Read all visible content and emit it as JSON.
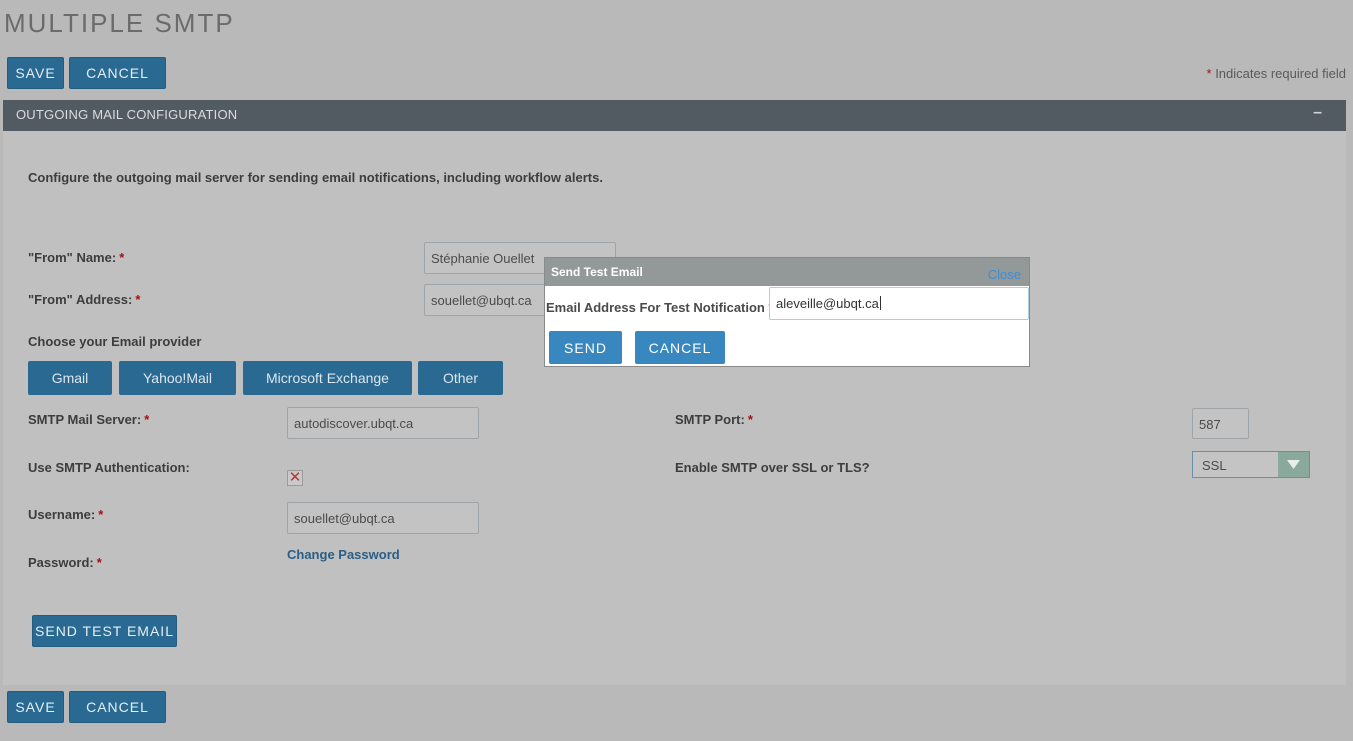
{
  "page": {
    "title": "MULTIPLE SMTP",
    "save_label": "SAVE",
    "cancel_label": "CANCEL",
    "required_star": "*",
    "required_note": "Indicates required field"
  },
  "panel": {
    "title": "OUTGOING MAIL CONFIGURATION",
    "collapse_symbol": "–",
    "description": "Configure the outgoing mail server for sending email notifications, including workflow alerts."
  },
  "form": {
    "from_name_label": "\"From\" Name:",
    "from_name_value": "Stéphanie Ouellet",
    "from_address_label": "\"From\" Address:",
    "from_address_value": "souellet@ubqt.ca",
    "provider_label": "Choose your Email provider",
    "providers": [
      "Gmail",
      "Yahoo!Mail",
      "Microsoft Exchange",
      "Other"
    ],
    "smtp_server_label": "SMTP Mail Server:",
    "smtp_server_value": "autodiscover.ubqt.ca",
    "smtp_port_label": "SMTP Port:",
    "smtp_port_value": "587",
    "use_auth_label": "Use SMTP Authentication:",
    "use_auth_checked": true,
    "ssl_label": "Enable SMTP over SSL or TLS?",
    "ssl_value": "SSL",
    "username_label": "Username:",
    "username_value": "souellet@ubqt.ca",
    "password_label": "Password:",
    "change_password_link": "Change Password",
    "send_test_label": "SEND TEST EMAIL"
  },
  "modal": {
    "title": "Send Test Email",
    "close_label": "Close",
    "field_label": "Email Address For Test Notification",
    "field_value": "aleveille@ubqt.ca",
    "send_label": "SEND",
    "cancel_label": "CANCEL"
  },
  "colors": {
    "button_bg": "#2a6a92",
    "header_bg": "#535b62",
    "required": "#a31111",
    "modal_button": "#3987bf"
  }
}
